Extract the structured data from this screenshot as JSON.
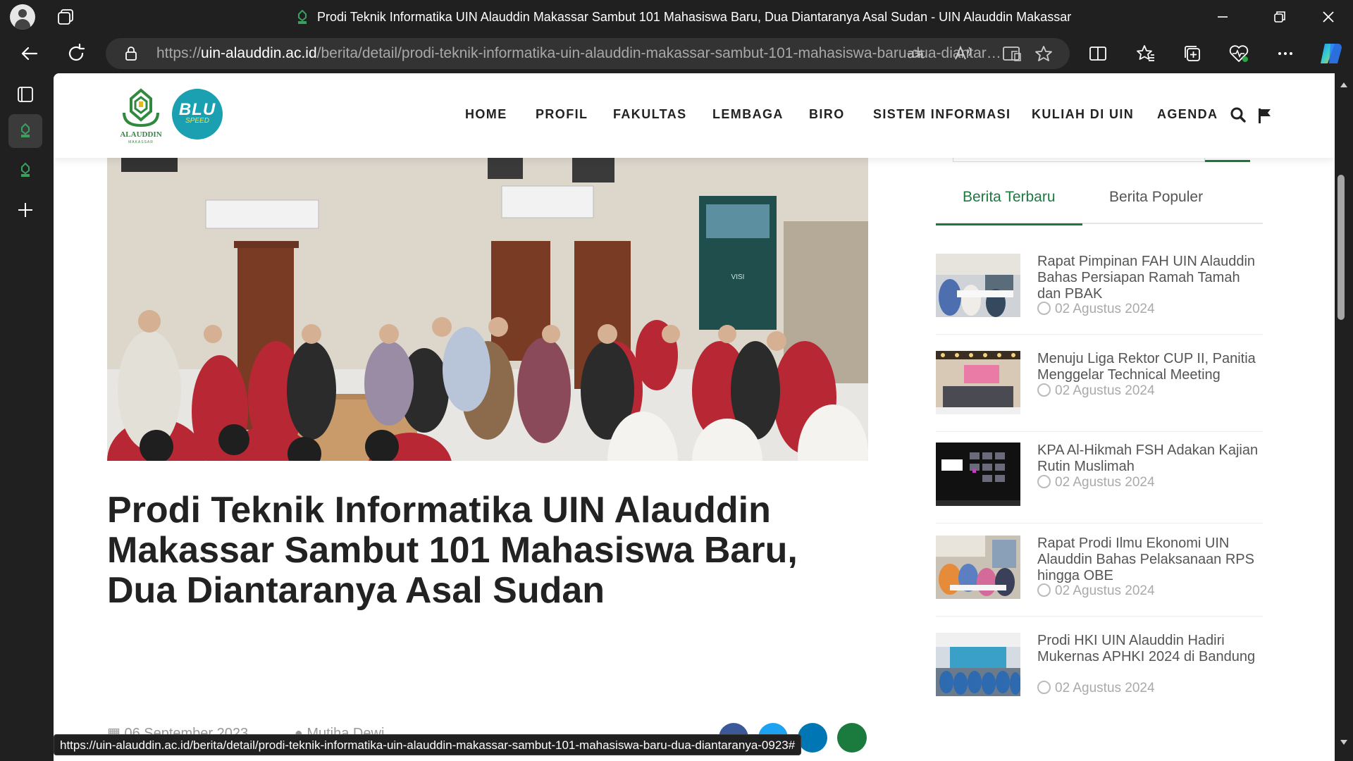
{
  "browser": {
    "tab_title": "Prodi Teknik Informatika UIN Alauddin Makassar Sambut 101 Mahasiswa Baru, Dua Diantaranya Asal Sudan - UIN Alauddin Makassar",
    "url_prefix": "https://",
    "url_host": "uin-alauddin.ac.id",
    "url_path": "/berita/detail/prodi-teknik-informatika-uin-alauddin-makassar-sambut-101-mahasiswa-baru-dua-diantaranya-0923",
    "status_url": "https://uin-alauddin.ac.id/berita/detail/prodi-teknik-informatika-uin-alauddin-makassar-sambut-101-mahasiswa-baru-dua-diantaranya-0923#",
    "accent": "#1b7a3e"
  },
  "site": {
    "logo_text": "ALAUDDIN",
    "logo_subtext": "MAKASSAR",
    "blu_text": "BLU",
    "blu_sub": "SPEED",
    "menu": [
      "HOME",
      "PROFIL",
      "FAKULTAS",
      "LEMBAGA",
      "BIRO",
      "SISTEM INFORMASI",
      "KULIAH DI UIN",
      "AGENDA"
    ]
  },
  "article": {
    "title": "Prodi Teknik Informatika UIN Alauddin Makassar Sambut 101 Mahasiswa Baru, Dua Diantaranya Asal Sudan",
    "date": "06 September 2023",
    "author": "Mutiha Dewi",
    "photo_poster_text": "VISI"
  },
  "sidebar": {
    "tabs": [
      "Berita Terbaru",
      "Berita Populer"
    ],
    "news": [
      {
        "title": "Rapat Pimpinan FAH UIN Alauddin Bahas Persiapan Ramah Tamah dan PBAK",
        "date": "02 Agustus 2024"
      },
      {
        "title": "Menuju Liga Rektor CUP II, Panitia Menggelar Technical Meeting",
        "date": "02 Agustus 2024"
      },
      {
        "title": "KPA Al-Hikmah FSH Adakan Kajian Rutin Muslimah",
        "date": "02 Agustus 2024"
      },
      {
        "title": "Rapat Prodi Ilmu Ekonomi UIN Alauddin Bahas Pelaksanaan RPS hingga OBE",
        "date": "02 Agustus 2024"
      },
      {
        "title": "Prodi HKI UIN Alauddin Hadiri Mukernas APHKI 2024 di Bandung",
        "date": "02 Agustus 2024"
      }
    ]
  }
}
